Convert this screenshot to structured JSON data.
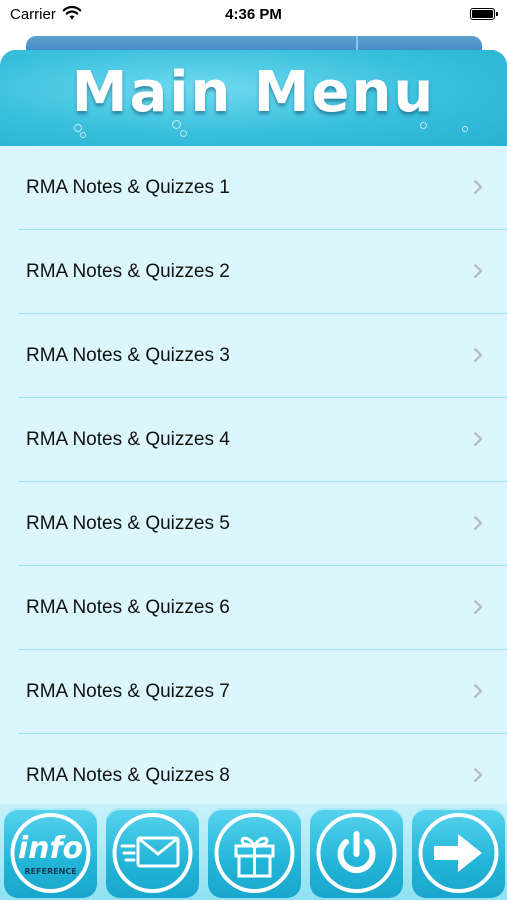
{
  "status_bar": {
    "carrier": "Carrier",
    "time": "4:36 PM"
  },
  "header": {
    "title": "Main Menu"
  },
  "menu": {
    "items": [
      {
        "label": "RMA Notes & Quizzes 1"
      },
      {
        "label": "RMA Notes & Quizzes 2"
      },
      {
        "label": "RMA Notes & Quizzes 3"
      },
      {
        "label": "RMA Notes & Quizzes 4"
      },
      {
        "label": "RMA Notes & Quizzes 5"
      },
      {
        "label": "RMA Notes & Quizzes 6"
      },
      {
        "label": "RMA Notes & Quizzes 7"
      },
      {
        "label": "RMA Notes & Quizzes 8"
      }
    ]
  },
  "toolbar": {
    "info_logo_text": "info",
    "info_logo_subtext": "REFERENCE",
    "icons": [
      "info-reference-icon",
      "email-icon",
      "gift-icon",
      "power-icon",
      "arrow-right-icon"
    ]
  },
  "colors": {
    "accent": "#41c6e2",
    "list_background": "#dbf6fc",
    "separator": "#9fe2f0",
    "header_text": "#ffffff"
  }
}
